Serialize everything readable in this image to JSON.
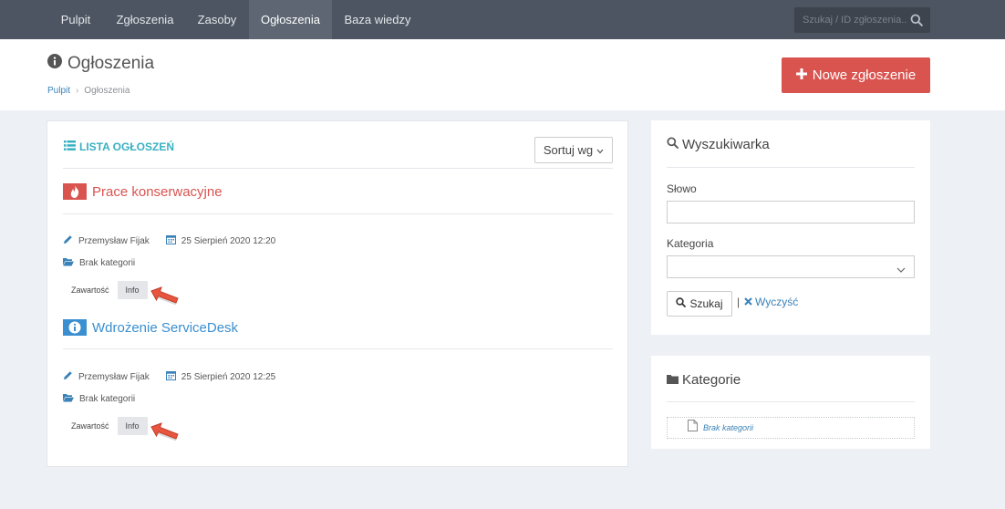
{
  "nav": {
    "items": [
      {
        "label": "Pulpit"
      },
      {
        "label": "Zgłoszenia"
      },
      {
        "label": "Zasoby"
      },
      {
        "label": "Ogłoszenia"
      },
      {
        "label": "Baza wiedzy"
      }
    ],
    "search_placeholder": "Szukaj / ID zgłoszenia..."
  },
  "header": {
    "title": "Ogłoszenia",
    "breadcrumb": {
      "home": "Pulpit",
      "separator": "›",
      "current": "Ogłoszenia"
    },
    "new_button": "Nowe zgłoszenie"
  },
  "list": {
    "title": "LISTA OGŁOSZEŃ",
    "sort_label": "Sortuj wg",
    "items": [
      {
        "title": "Prace konserwacyjne",
        "color": "#d9534f",
        "icon": "fire-icon",
        "author": "Przemysław Fijak",
        "date": "25 Sierpień 2020 12:20",
        "category": "Brak kategorii",
        "tab_content": "Zawartość",
        "tab_info": "Info"
      },
      {
        "title": "Wdrożenie ServiceDesk",
        "color": "#3a8fd0",
        "icon": "info-icon",
        "author": "Przemysław Fijak",
        "date": "25 Sierpień 2020 12:25",
        "category": "Brak kategorii",
        "tab_content": "Zawartość",
        "tab_info": "Info"
      }
    ]
  },
  "search_panel": {
    "title": "Wyszukiwarka",
    "word_label": "Słowo",
    "word_value": "",
    "category_label": "Kategoria",
    "category_value": "",
    "search_button": "Szukaj",
    "separator": "|",
    "clear_link": "Wyczyść"
  },
  "categories_panel": {
    "title": "Kategorie",
    "items": [
      {
        "label": "Brak kategorii"
      }
    ]
  },
  "colors": {
    "accent": "#3ab0c3",
    "danger": "#d9534f",
    "link": "#3a82b8",
    "nav_bg": "#4c5561"
  }
}
